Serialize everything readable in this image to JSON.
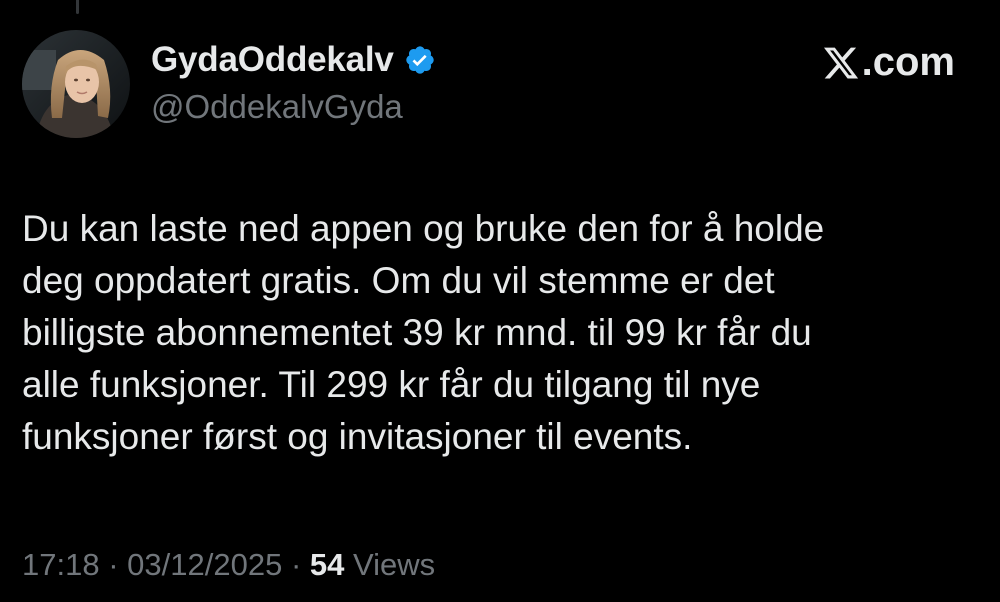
{
  "author": {
    "display_name": "GydaOddekalv",
    "handle": "@OddekalvGyda",
    "verified_icon": "verified-badge-icon",
    "verified_color": "#1d9bf0"
  },
  "brand": {
    "label": ".com",
    "logo_icon": "x-logo-icon"
  },
  "tweet": {
    "lines": [
      "Du kan laste ned appen og bruke den for å holde",
      "deg oppdatert gratis. Om du vil stemme er det",
      "billigste abonnementet 39 kr mnd. til 99 kr får du",
      "alle funksjoner. Til 299 kr får du tilgang til nye",
      "funksjoner først og invitasjoner til events."
    ]
  },
  "meta": {
    "time": "17:18",
    "separator": "·",
    "date": "03/12/2025",
    "views_count": "54",
    "views_label": "Views"
  },
  "colors": {
    "background": "#000000",
    "text_primary": "#e7e9ea",
    "text_secondary": "#71767b",
    "accent": "#1d9bf0"
  }
}
